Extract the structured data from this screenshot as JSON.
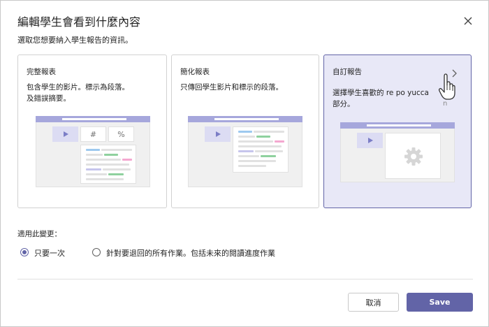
{
  "dialog": {
    "title": "編輯學生會看到什麼內容",
    "subtitle": "選取您想要納入學生報告的資訊。",
    "close_icon": "close-icon"
  },
  "cards": [
    {
      "title": "完整報表",
      "description": "包含學生的影片。標示為段落。及錯誤摘要。",
      "symbol_hash": "#",
      "symbol_percent": "%"
    },
    {
      "title": "簡化報表",
      "description": "只傳回學生影片和標示的段落。"
    },
    {
      "title": "自訂報告",
      "description": "選擇學生喜歡的 re po yucca 部分。",
      "stray_glyph": "n",
      "selected": true
    }
  ],
  "apply": {
    "label": "適用此變更：",
    "options": [
      {
        "label": "只要一次",
        "checked": true
      },
      {
        "label": "針對要退回的所有作業。包括未來的閱讀進度作業",
        "checked": false
      }
    ]
  },
  "buttons": {
    "cancel": "取消",
    "save": "Save"
  },
  "colors": {
    "accent": "#6264a7",
    "selected_card_bg": "#e8e8f7"
  }
}
